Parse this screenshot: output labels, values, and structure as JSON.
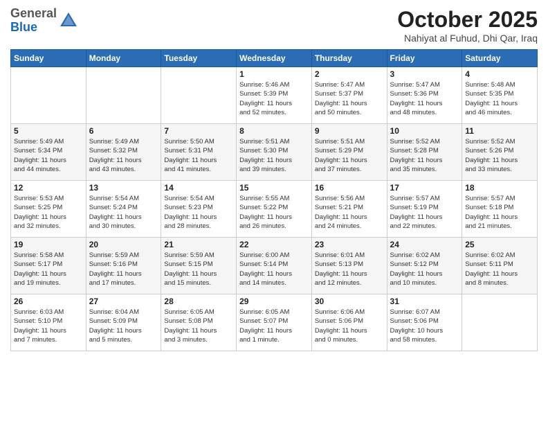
{
  "header": {
    "logo_general": "General",
    "logo_blue": "Blue",
    "month": "October 2025",
    "location": "Nahiyat al Fuhud, Dhi Qar, Iraq"
  },
  "weekdays": [
    "Sunday",
    "Monday",
    "Tuesday",
    "Wednesday",
    "Thursday",
    "Friday",
    "Saturday"
  ],
  "weeks": [
    [
      {
        "day": "",
        "info": ""
      },
      {
        "day": "",
        "info": ""
      },
      {
        "day": "",
        "info": ""
      },
      {
        "day": "1",
        "info": "Sunrise: 5:46 AM\nSunset: 5:39 PM\nDaylight: 11 hours\nand 52 minutes."
      },
      {
        "day": "2",
        "info": "Sunrise: 5:47 AM\nSunset: 5:37 PM\nDaylight: 11 hours\nand 50 minutes."
      },
      {
        "day": "3",
        "info": "Sunrise: 5:47 AM\nSunset: 5:36 PM\nDaylight: 11 hours\nand 48 minutes."
      },
      {
        "day": "4",
        "info": "Sunrise: 5:48 AM\nSunset: 5:35 PM\nDaylight: 11 hours\nand 46 minutes."
      }
    ],
    [
      {
        "day": "5",
        "info": "Sunrise: 5:49 AM\nSunset: 5:34 PM\nDaylight: 11 hours\nand 44 minutes."
      },
      {
        "day": "6",
        "info": "Sunrise: 5:49 AM\nSunset: 5:32 PM\nDaylight: 11 hours\nand 43 minutes."
      },
      {
        "day": "7",
        "info": "Sunrise: 5:50 AM\nSunset: 5:31 PM\nDaylight: 11 hours\nand 41 minutes."
      },
      {
        "day": "8",
        "info": "Sunrise: 5:51 AM\nSunset: 5:30 PM\nDaylight: 11 hours\nand 39 minutes."
      },
      {
        "day": "9",
        "info": "Sunrise: 5:51 AM\nSunset: 5:29 PM\nDaylight: 11 hours\nand 37 minutes."
      },
      {
        "day": "10",
        "info": "Sunrise: 5:52 AM\nSunset: 5:28 PM\nDaylight: 11 hours\nand 35 minutes."
      },
      {
        "day": "11",
        "info": "Sunrise: 5:52 AM\nSunset: 5:26 PM\nDaylight: 11 hours\nand 33 minutes."
      }
    ],
    [
      {
        "day": "12",
        "info": "Sunrise: 5:53 AM\nSunset: 5:25 PM\nDaylight: 11 hours\nand 32 minutes."
      },
      {
        "day": "13",
        "info": "Sunrise: 5:54 AM\nSunset: 5:24 PM\nDaylight: 11 hours\nand 30 minutes."
      },
      {
        "day": "14",
        "info": "Sunrise: 5:54 AM\nSunset: 5:23 PM\nDaylight: 11 hours\nand 28 minutes."
      },
      {
        "day": "15",
        "info": "Sunrise: 5:55 AM\nSunset: 5:22 PM\nDaylight: 11 hours\nand 26 minutes."
      },
      {
        "day": "16",
        "info": "Sunrise: 5:56 AM\nSunset: 5:21 PM\nDaylight: 11 hours\nand 24 minutes."
      },
      {
        "day": "17",
        "info": "Sunrise: 5:57 AM\nSunset: 5:19 PM\nDaylight: 11 hours\nand 22 minutes."
      },
      {
        "day": "18",
        "info": "Sunrise: 5:57 AM\nSunset: 5:18 PM\nDaylight: 11 hours\nand 21 minutes."
      }
    ],
    [
      {
        "day": "19",
        "info": "Sunrise: 5:58 AM\nSunset: 5:17 PM\nDaylight: 11 hours\nand 19 minutes."
      },
      {
        "day": "20",
        "info": "Sunrise: 5:59 AM\nSunset: 5:16 PM\nDaylight: 11 hours\nand 17 minutes."
      },
      {
        "day": "21",
        "info": "Sunrise: 5:59 AM\nSunset: 5:15 PM\nDaylight: 11 hours\nand 15 minutes."
      },
      {
        "day": "22",
        "info": "Sunrise: 6:00 AM\nSunset: 5:14 PM\nDaylight: 11 hours\nand 14 minutes."
      },
      {
        "day": "23",
        "info": "Sunrise: 6:01 AM\nSunset: 5:13 PM\nDaylight: 11 hours\nand 12 minutes."
      },
      {
        "day": "24",
        "info": "Sunrise: 6:02 AM\nSunset: 5:12 PM\nDaylight: 11 hours\nand 10 minutes."
      },
      {
        "day": "25",
        "info": "Sunrise: 6:02 AM\nSunset: 5:11 PM\nDaylight: 11 hours\nand 8 minutes."
      }
    ],
    [
      {
        "day": "26",
        "info": "Sunrise: 6:03 AM\nSunset: 5:10 PM\nDaylight: 11 hours\nand 7 minutes."
      },
      {
        "day": "27",
        "info": "Sunrise: 6:04 AM\nSunset: 5:09 PM\nDaylight: 11 hours\nand 5 minutes."
      },
      {
        "day": "28",
        "info": "Sunrise: 6:05 AM\nSunset: 5:08 PM\nDaylight: 11 hours\nand 3 minutes."
      },
      {
        "day": "29",
        "info": "Sunrise: 6:05 AM\nSunset: 5:07 PM\nDaylight: 11 hours\nand 1 minute."
      },
      {
        "day": "30",
        "info": "Sunrise: 6:06 AM\nSunset: 5:06 PM\nDaylight: 11 hours\nand 0 minutes."
      },
      {
        "day": "31",
        "info": "Sunrise: 6:07 AM\nSunset: 5:06 PM\nDaylight: 10 hours\nand 58 minutes."
      },
      {
        "day": "",
        "info": ""
      }
    ]
  ]
}
